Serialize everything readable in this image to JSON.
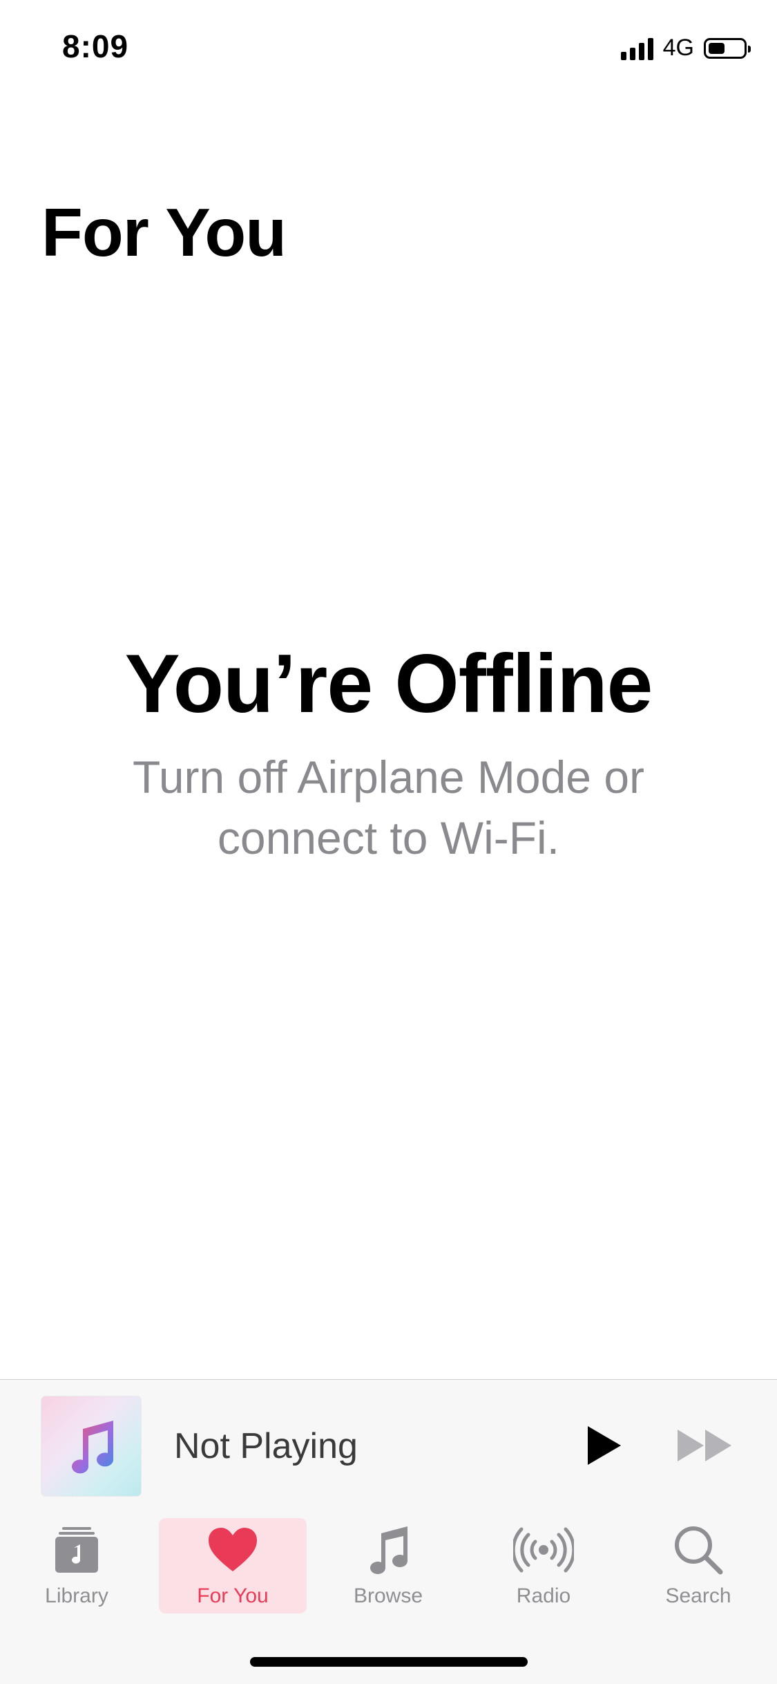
{
  "status_bar": {
    "time": "8:09",
    "network": "4G",
    "battery_level": 0.45
  },
  "header": {
    "title": "For You"
  },
  "offline": {
    "title": "You’re Offline",
    "message": "Turn off Airplane Mode or connect to Wi-Fi."
  },
  "mini_player": {
    "title": "Not Playing",
    "artwork_icon": "music-note-icon",
    "play_icon": "play-icon",
    "forward_icon": "fast-forward-icon"
  },
  "tab_bar": {
    "accent_color": "#e93b57",
    "inactive_color": "#8e8e93",
    "tabs": [
      {
        "label": "Library",
        "icon": "library-icon",
        "selected": false
      },
      {
        "label": "For You",
        "icon": "heart-icon",
        "selected": true
      },
      {
        "label": "Browse",
        "icon": "music-note-icon",
        "selected": false
      },
      {
        "label": "Radio",
        "icon": "radio-icon",
        "selected": false
      },
      {
        "label": "Search",
        "icon": "search-icon",
        "selected": false
      }
    ]
  }
}
